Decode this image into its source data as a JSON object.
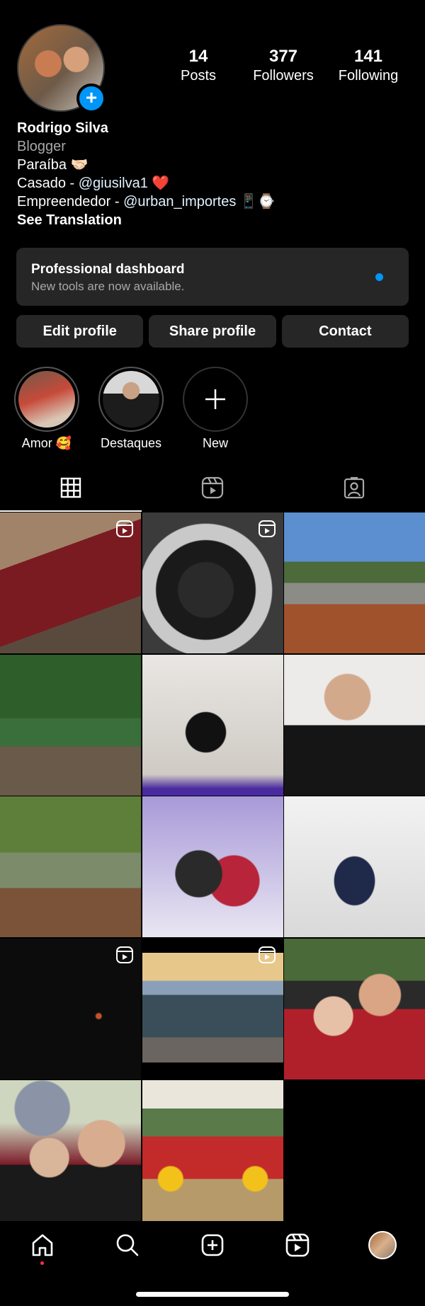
{
  "profile": {
    "name": "Rodrigo Silva",
    "category": "Blogger",
    "bio_line1": "Paraíba 🤝🏻",
    "bio_line2_prefix": "Casado - ",
    "bio_line2_mention": "@giusilva1",
    "bio_line2_suffix": " ❤️",
    "bio_line3_prefix": "Empreendedor - ",
    "bio_line3_mention": "@urban_importes",
    "bio_line3_suffix": " 📱⌚",
    "see_translation": "See Translation"
  },
  "stats": [
    {
      "value": "14",
      "label": "Posts"
    },
    {
      "value": "377",
      "label": "Followers"
    },
    {
      "value": "141",
      "label": "Following"
    }
  ],
  "dashboard": {
    "title": "Professional dashboard",
    "subtitle": "New tools are now available."
  },
  "buttons": {
    "edit": "Edit profile",
    "share": "Share profile",
    "contact": "Contact"
  },
  "highlights": [
    {
      "label": "Amor 🥰"
    },
    {
      "label": "Destaques"
    },
    {
      "label": "New"
    }
  ],
  "grid": {
    "posts": [
      {
        "icon": "red-car-photo",
        "reel": true
      },
      {
        "icon": "steering-wheel-photo",
        "reel": true
      },
      {
        "icon": "lake-selfie-photo",
        "reel": false
      },
      {
        "icon": "garden-portrait-photo",
        "reel": false
      },
      {
        "icon": "mirror-selfie-photo",
        "reel": false
      },
      {
        "icon": "jersey-selfie-photo",
        "reel": false
      },
      {
        "icon": "garden-standing-photo",
        "reel": false
      },
      {
        "icon": "couple-mirror-photo",
        "reel": false
      },
      {
        "icon": "jacket-mirror-photo",
        "reel": false
      },
      {
        "icon": "night-fire-photo",
        "reel": true
      },
      {
        "icon": "grey-car-photo",
        "reel": true
      },
      {
        "icon": "couple-selfie-red-photo",
        "reel": false
      },
      {
        "icon": "couple-beanie-photo",
        "reel": false
      },
      {
        "icon": "primavera-couple-photo",
        "reel": false
      }
    ]
  },
  "colors": {
    "background": "#000000",
    "surface": "#262626",
    "accent": "#0095f6",
    "secondary_text": "#a8a8a8",
    "notification": "#ff3040"
  }
}
